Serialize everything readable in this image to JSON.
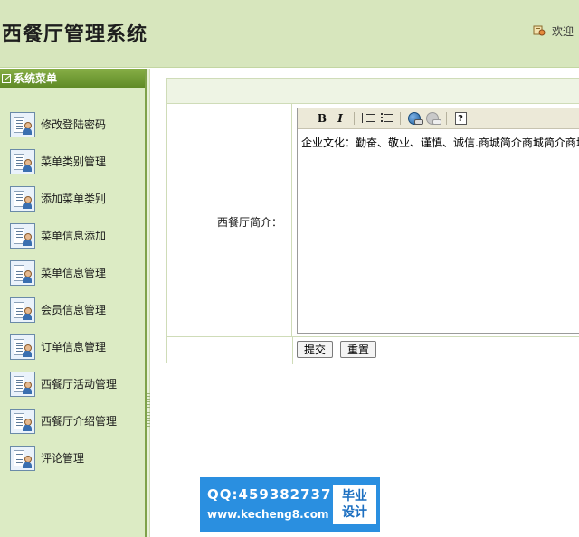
{
  "header": {
    "title": "西餐厅管理系统",
    "welcome_text": "欢迎"
  },
  "sidebar": {
    "heading": "系统菜单",
    "items": [
      {
        "label": "修改登陆密码"
      },
      {
        "label": "菜单类别管理"
      },
      {
        "label": "添加菜单类别"
      },
      {
        "label": "菜单信息添加"
      },
      {
        "label": "菜单信息管理"
      },
      {
        "label": "会员信息管理"
      },
      {
        "label": "订单信息管理"
      },
      {
        "label": "西餐厅活动管理"
      },
      {
        "label": "西餐厅介绍管理"
      },
      {
        "label": "评论管理"
      }
    ]
  },
  "form": {
    "field_label": "西餐厅简介：",
    "editor_content": "企业文化：勤奋、敬业、谨慎、诚信.商城简介商城简介商城",
    "toolbar": {
      "bold": "B",
      "italic": "I",
      "help": "?"
    },
    "submit_label": "提交",
    "reset_label": "重置"
  },
  "watermark": {
    "qq": "QQ:459382737",
    "url": "www.kecheng8.com",
    "badge_line1": "毕业",
    "badge_line2": "设计"
  },
  "colors": {
    "header_bg": "#d7e6bd",
    "sidebar_bg": "#dcebc4",
    "sidebar_head": "#6f9a33",
    "watermark_bg": "#2a8fe0"
  }
}
